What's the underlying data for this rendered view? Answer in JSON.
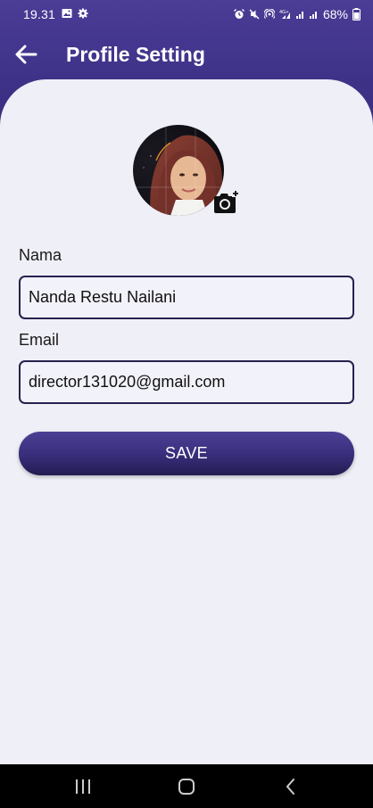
{
  "status_bar": {
    "time": "19.31",
    "left_icons": [
      "image-icon",
      "gear-icon"
    ],
    "right_icons": [
      "alarm-icon",
      "mute-icon",
      "hotspot-icon",
      "signal-4g-icon",
      "signal-icon",
      "signal-icon-2",
      "battery-icon"
    ],
    "network_label": "4G+",
    "battery_percent": "68%"
  },
  "app_bar": {
    "back_icon": "arrow-left-icon",
    "title": "Profile Setting"
  },
  "profile": {
    "avatar_icon": "avatar-photo",
    "camera_icon": "camera-add-icon"
  },
  "form": {
    "name_label": "Nama",
    "name_value": "Nanda Restu Nailani",
    "email_label": "Email",
    "email_value": "director131020@gmail.com",
    "save_label": "SAVE"
  },
  "nav_bar": {
    "recents_icon": "recents-icon",
    "home_icon": "home-icon",
    "back_icon": "back-chevron-icon"
  },
  "colors": {
    "header_gradient_top": "#4b3c96",
    "header_gradient_bottom": "#392d80",
    "background": "#efeff7",
    "field_border": "#27214f",
    "button_top": "#4b3f94",
    "button_bottom": "#231c52"
  }
}
